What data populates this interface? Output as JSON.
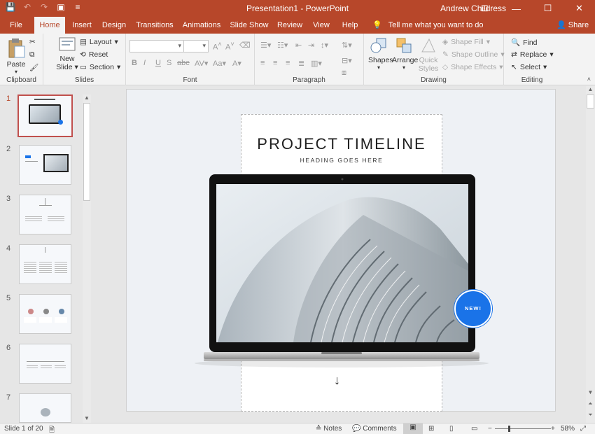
{
  "window": {
    "title": "Presentation1  -  PowerPoint",
    "user": "Andrew Childress"
  },
  "tabs": [
    "File",
    "Home",
    "Insert",
    "Design",
    "Transitions",
    "Animations",
    "Slide Show",
    "Review",
    "View",
    "Help"
  ],
  "active_tab": "Home",
  "tell_me": "Tell me what you want to do",
  "share": "Share",
  "ribbon": {
    "clipboard": {
      "label": "Clipboard",
      "paste": "Paste"
    },
    "slides": {
      "label": "Slides",
      "new_slide_1": "New",
      "new_slide_2": "Slide",
      "layout": "Layout",
      "reset": "Reset",
      "section": "Section"
    },
    "font": {
      "label": "Font"
    },
    "paragraph": {
      "label": "Paragraph"
    },
    "drawing": {
      "label": "Drawing",
      "shapes": "Shapes",
      "arrange": "Arrange",
      "quick_styles_1": "Quick",
      "quick_styles_2": "Styles",
      "shape_fill": "Shape Fill",
      "shape_outline": "Shape Outline",
      "shape_effects": "Shape Effects"
    },
    "editing": {
      "label": "Editing",
      "find": "Find",
      "replace": "Replace",
      "select": "Select"
    }
  },
  "thumbnails": [
    "1",
    "2",
    "3",
    "4",
    "5",
    "6",
    "7"
  ],
  "active_slide": "1",
  "slide": {
    "title": "PROJECT TIMELINE",
    "subtitle": "HEADING GOES HERE",
    "badge": "NEW!"
  },
  "status": {
    "slide_indicator": "Slide 1 of 20",
    "notes": "Notes",
    "comments": "Comments",
    "zoom": "58%"
  },
  "colors": {
    "accent": "#b7472a",
    "badge": "#1a73e8"
  }
}
